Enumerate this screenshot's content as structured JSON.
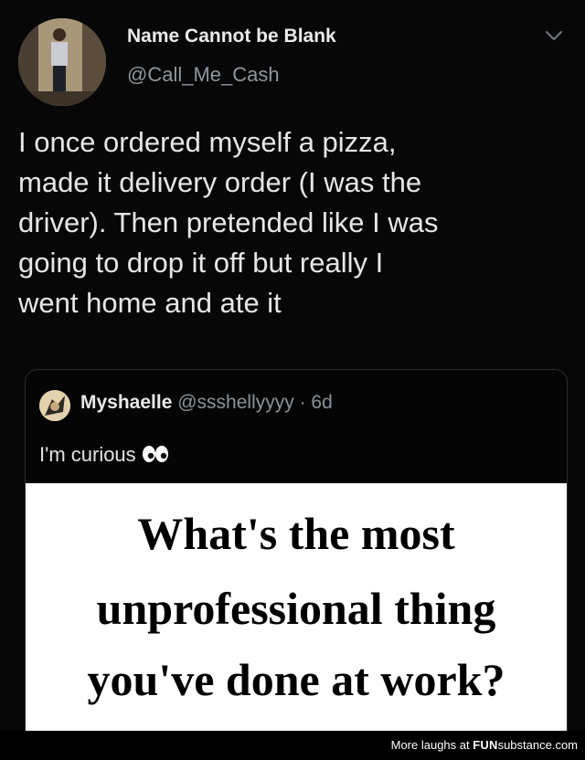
{
  "tweet": {
    "author_name": "Name Cannot be Blank",
    "author_handle": "@Call_Me_Cash",
    "text_lines": [
      "I once ordered myself a pizza,",
      "made it delivery order (I was the",
      "driver). Then pretended like I was",
      "going to drop it off but really I",
      "went home and ate it"
    ]
  },
  "quote": {
    "author_name": "Myshaelle",
    "author_handle": "@ssshellyyyy",
    "separator": " · ",
    "age": "6d",
    "text": "I'm curious",
    "emoji_icon": "eyes-icon",
    "image_text_lines": [
      "What's the most",
      "unprofessional thing",
      "you've done at work?"
    ]
  },
  "footer": {
    "prefix": "More laughs at ",
    "brand_part1": "FUN",
    "brand_part2": "substance",
    "brand_part3": ".com"
  },
  "colors": {
    "background": "#000000",
    "secondary_text": "#8e969d",
    "primary_text": "#e7e9ea"
  }
}
